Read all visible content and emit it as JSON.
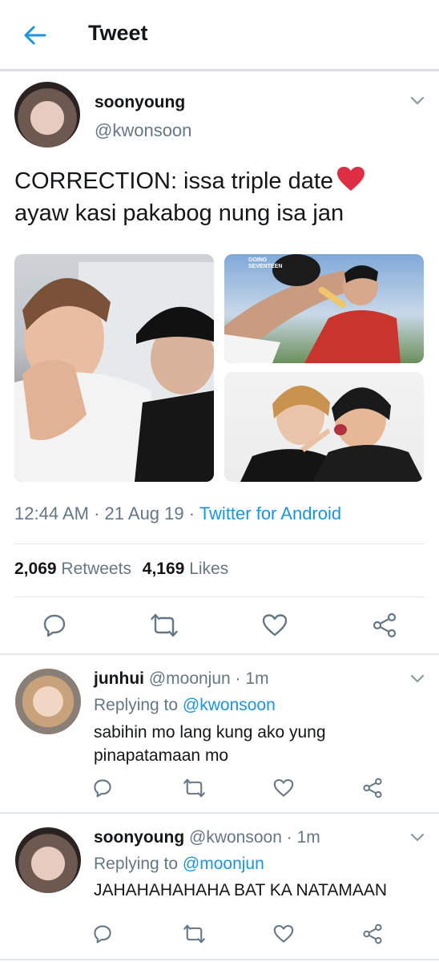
{
  "header": {
    "title": "Tweet"
  },
  "tweet": {
    "display_name": "soonyoung",
    "handle": "@kwonsoon",
    "text_line1": "CORRECTION: issa triple date",
    "text_line2": "ayaw kasi pakabog nung isa jan",
    "emoji": "red-heart",
    "time": "12:44 AM",
    "date": "21 Aug 19",
    "separator": "·",
    "source": "Twitter for Android",
    "retweets_count": "2,069",
    "retweets_label": "Retweets",
    "likes_count": "4,169",
    "likes_label": "Likes",
    "image_overlay_text": "GOING\nSEVENTEEN"
  },
  "replies": [
    {
      "display_name": "junhui",
      "handle": "@moonjun",
      "separator": "·",
      "time": "1m",
      "replying_prefix": "Replying to",
      "replying_to": "@kwonsoon",
      "text_line1": "sabihin mo lang kung ako yung",
      "text_line2": "pinapatamaan mo"
    },
    {
      "display_name": "soonyoung",
      "handle": "@kwonsoon",
      "separator": "·",
      "time": "1m",
      "replying_prefix": "Replying to",
      "replying_to": "@moonjun",
      "text_line1": "JAHAHAHAHAHA BAT KA NATAMAAN",
      "text_line2": ""
    }
  ],
  "icons": [
    "back-arrow-icon",
    "chevron-down-icon",
    "reply-icon",
    "retweet-icon",
    "like-icon",
    "share-icon"
  ],
  "colors": {
    "accent": "#1b95e0",
    "muted": "#657786",
    "divider": "#e1e8ed",
    "heart": "#e0245e"
  }
}
